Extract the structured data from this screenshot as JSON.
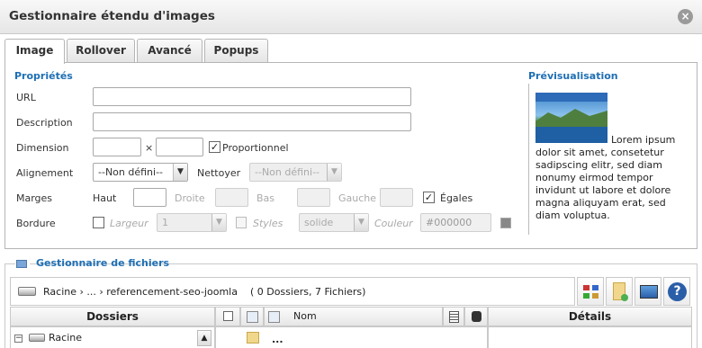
{
  "window": {
    "title": "Gestionnaire étendu d'images"
  },
  "tabs": [
    {
      "label": "Image"
    },
    {
      "label": "Rollover"
    },
    {
      "label": "Avancé"
    },
    {
      "label": "Popups"
    }
  ],
  "properties": {
    "title": "Propriétés",
    "url_label": "URL",
    "url_value": "",
    "description_label": "Description",
    "description_value": "",
    "dimension_label": "Dimension",
    "dimension_separator": "×",
    "proportional_label": "Proportionnel",
    "proportional_checked": true,
    "alignment_label": "Alignement",
    "alignment_value": "--Non défini--",
    "clear_label": "Nettoyer",
    "clear_value": "--Non défini--",
    "margins_label": "Marges",
    "top_label": "Haut",
    "right_label": "Droite",
    "bottom_label": "Bas",
    "left_label": "Gauche",
    "equal_label": "Égales",
    "equal_checked": true,
    "border_label": "Bordure",
    "width_label": "Largeur",
    "width_value": "1",
    "styles_label": "Styles",
    "styles_value": "solide",
    "color_label": "Couleur",
    "color_value": "#000000"
  },
  "preview": {
    "title": "Prévisualisation",
    "text": "Lorem ipsum dolor sit amet, consetetur sadipscing elitr, sed diam nonumy eirmod tempor invidunt ut labore et dolore magna aliquyam erat, sed diam voluptua."
  },
  "file_manager": {
    "title": "Gestionnaire de fichiers",
    "path": "Racine › ... › referencement-seo-joomla",
    "summary": "( 0 Dossiers, 7 Fichiers)",
    "folders_header": "Dossiers",
    "name_header": "Nom",
    "details_header": "Détails",
    "root_label": "Racine",
    "parent_item": "..."
  },
  "colors": {
    "accent": "#1f6fb4",
    "border": "#b5b5b5"
  }
}
